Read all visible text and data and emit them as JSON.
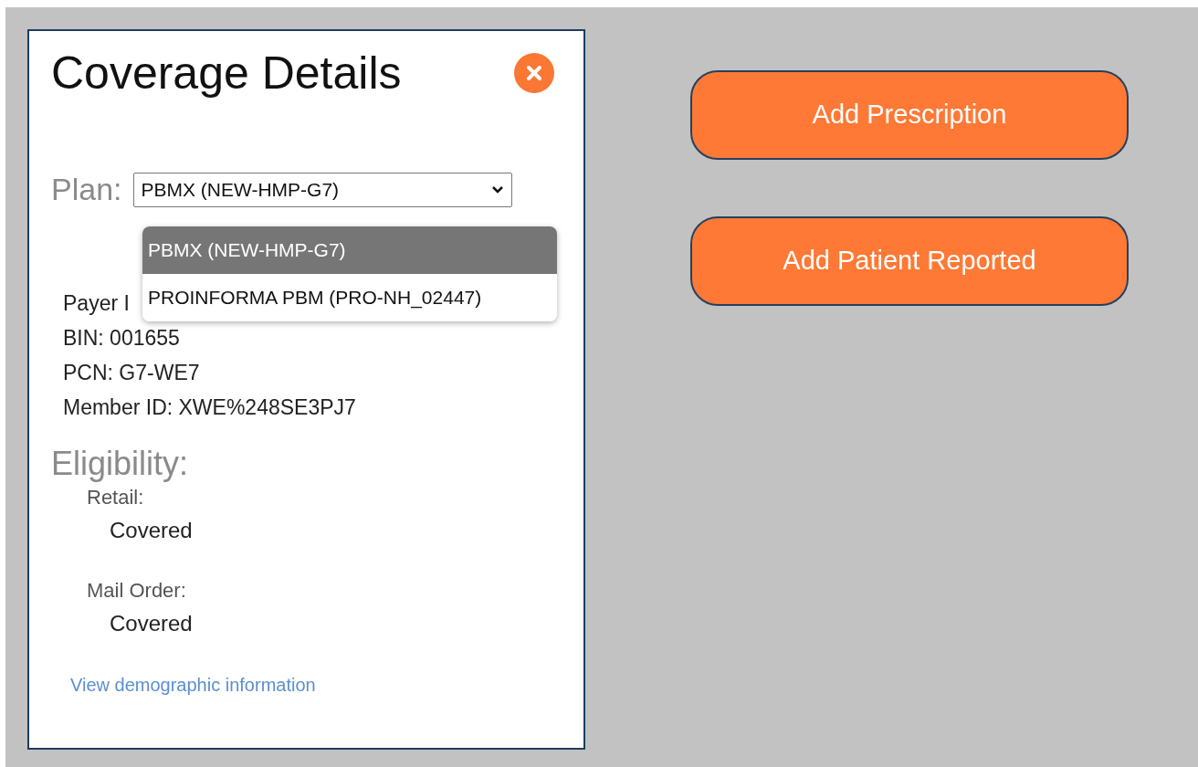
{
  "panel": {
    "title": "Coverage Details",
    "plan": {
      "label": "Plan:",
      "value": "PBMX (NEW-HMP-G7)",
      "expanded": true,
      "options": [
        {
          "label": "PBMX (NEW-HMP-G7)",
          "selected": true
        },
        {
          "label": "PROINFORMA PBM (PRO-NH_02447)",
          "selected": false
        }
      ]
    },
    "details": [
      "Payer I",
      "BIN: 001655",
      "PCN: G7-WE7",
      "Member ID: XWE%248SE3PJ7"
    ],
    "eligibility": {
      "heading": "Eligibility:",
      "items": [
        {
          "label": "Retail:",
          "value": "Covered"
        },
        {
          "label": "Mail Order:",
          "value": "Covered"
        }
      ]
    },
    "link": "View demographic information"
  },
  "buttons": [
    "Add Prescription",
    "Add Patient Reported"
  ]
}
